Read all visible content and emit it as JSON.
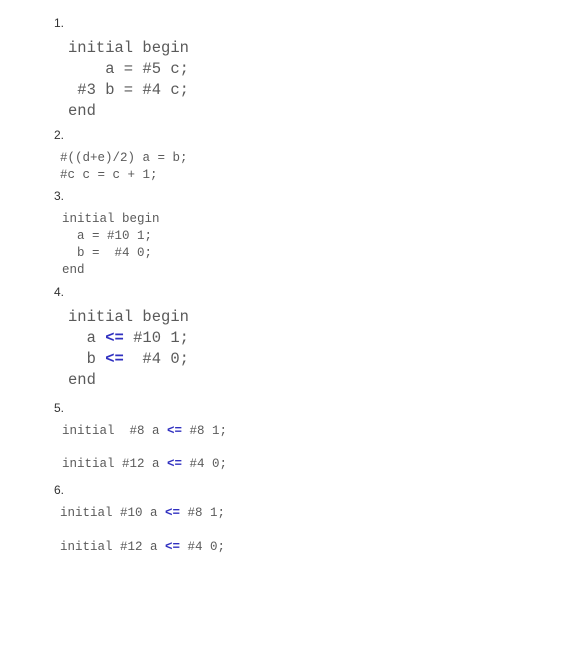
{
  "items": [
    {
      "num": "1."
    },
    {
      "num": "2."
    },
    {
      "num": "3."
    },
    {
      "num": "4."
    },
    {
      "num": "5."
    },
    {
      "num": "6."
    }
  ],
  "code1": {
    "l1": "initial begin",
    "l2": "    a = #5 c;",
    "l3": " #3 b = #4 c;",
    "l4": "end"
  },
  "code2": {
    "l1": "#((d+e)/2) a = b;",
    "l2": "#c c = c + 1;"
  },
  "code3": {
    "l1": "initial begin",
    "l2": "  a = #10 1;",
    "l3": "  b =  #4 0;",
    "l4": "end"
  },
  "code4": {
    "l1": "initial begin",
    "l2a": "  a ",
    "op": "<=",
    "l2b": " #10 1;",
    "l3a": "  b ",
    "l3b": "  #4 0;",
    "l4": "end"
  },
  "code5": {
    "l1a": "initial  #8 a ",
    "l1b": " #8 1;",
    "l2a": "initial #12 a ",
    "l2b": " #4 0;"
  },
  "code6": {
    "l1a": "initial #10 a ",
    "l1b": " #8 1;",
    "l2a": "initial #12 a ",
    "l2b": " #4 0;"
  }
}
